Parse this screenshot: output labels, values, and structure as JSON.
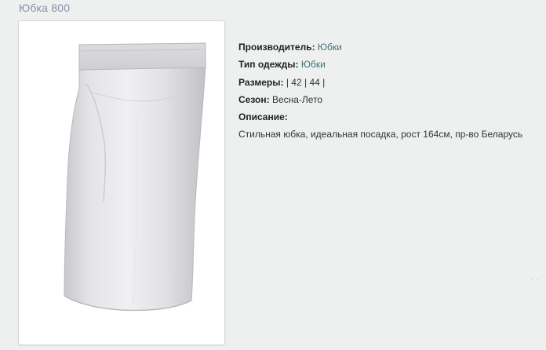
{
  "page": {
    "title": "Юбка 800"
  },
  "product_image": {
    "icon": "skirt-photo",
    "alt": ""
  },
  "details": {
    "manufacturer_label": "Производитель:",
    "manufacturer_value": "Юбки",
    "clothing_type_label": "Тип одежды:",
    "clothing_type_value": "Юбки",
    "sizes_label": "Размеры:",
    "sizes_prefix": "|",
    "sizes": [
      "42",
      "44"
    ],
    "sizes_separator": "|",
    "season_label": "Сезон:",
    "season_value": "Весна-Лето",
    "description_label": "Описание:",
    "description_text": "Стильная юбка, идеальная посадка, рост 164см, пр-во Беларусь"
  },
  "misc": {
    "dots": ". ."
  },
  "colors": {
    "background": "#eef0f0",
    "title": "#8a8fa6",
    "link": "#3b7178",
    "text": "#2b2b2b"
  }
}
